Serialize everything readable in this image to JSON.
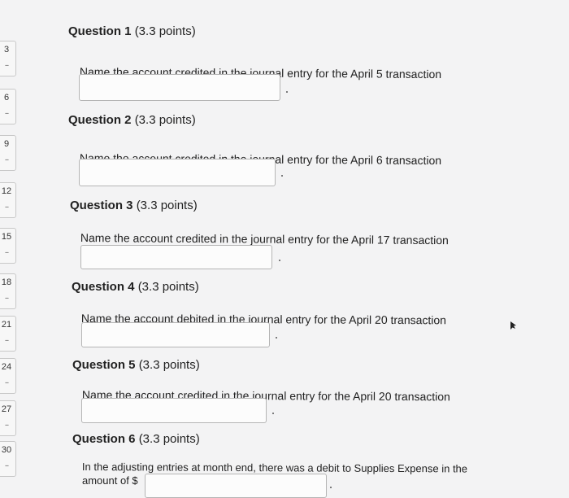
{
  "nav": {
    "items": [
      {
        "label": "3",
        "status": "--"
      },
      {
        "label": "6",
        "status": "--"
      },
      {
        "label": "9",
        "status": "--"
      },
      {
        "label": "12",
        "status": "--"
      },
      {
        "label": "15",
        "status": "--"
      },
      {
        "label": "18",
        "status": "--"
      },
      {
        "label": "21",
        "status": "--"
      },
      {
        "label": "24",
        "status": "--"
      },
      {
        "label": "27",
        "status": "--"
      },
      {
        "label": "30",
        "status": "--"
      }
    ]
  },
  "questions": [
    {
      "title": "Question 1",
      "points": "(3.3 points)",
      "prompt": "Name the account credited in the journal entry for the April 5 transaction",
      "answer": ""
    },
    {
      "title": "Question 2",
      "points": "(3.3 points)",
      "prompt": "Name the account credited in the journal entry for the April 6 transaction",
      "answer": ""
    },
    {
      "title": "Question 3",
      "points": "(3.3 points)",
      "prompt": "Name the account credited in the journal entry for the April 17 transaction",
      "answer": ""
    },
    {
      "title": "Question 4",
      "points": "(3.3 points)",
      "prompt": "Name the account debited in the journal entry for the April 20 transaction",
      "answer": ""
    },
    {
      "title": "Question 5",
      "points": "(3.3 points)",
      "prompt": "Name the account credited in the journal entry for the April 20 transaction",
      "answer": ""
    },
    {
      "title": "Question 6",
      "points": "(3.3 points)",
      "prompt_line1": "In the adjusting entries at month end, there was a debit to Supplies Expense in the",
      "prompt_line2": "amount of $",
      "answer": ""
    }
  ]
}
